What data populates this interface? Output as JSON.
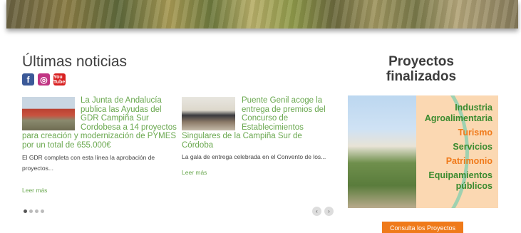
{
  "news": {
    "title": "Últimas noticias",
    "social": {
      "facebook": "f",
      "instagram": "◎",
      "youtube": "You Tube"
    },
    "items": [
      {
        "title": "La Junta de Andalucía publica las Ayudas del GDR Campiña Sur Cordobesa a 14 proyectos para creación y modernización de PYMES por un total de 655.000€",
        "summary": "El GDR completa con esta línea la aprobación de proyectos...",
        "more": "Leer más"
      },
      {
        "title": "Puente Genil acoge la entrega de premios del Concurso de Establecimientos Singulares de la Campiña Sur de Córdoba",
        "summary": "La gala de entrega celebrada en el Convento de los...",
        "more": "Leer más"
      }
    ],
    "slider": {
      "pages": 4,
      "current": 1,
      "prev": "‹",
      "next": "›"
    }
  },
  "projects": {
    "title": "Proyectos finalizados",
    "banner_words": [
      {
        "text": "Industria",
        "color": "#3a8a2e"
      },
      {
        "text": "Agroalimentaria",
        "color": "#3a8a2e"
      },
      {
        "text": "Turismo",
        "color": "#f07a1a"
      },
      {
        "text": "Servicios",
        "color": "#3a8a2e"
      },
      {
        "text": "Patrimonio",
        "color": "#f07a1a"
      },
      {
        "text": "Equipamientos",
        "color": "#3a8a2e"
      },
      {
        "text": "públicos",
        "color": "#3a8a2e"
      }
    ],
    "button": "Consulta los Proyectos"
  },
  "colors": {
    "accent_green": "#6aa84f",
    "accent_orange": "#ef7a1a"
  }
}
